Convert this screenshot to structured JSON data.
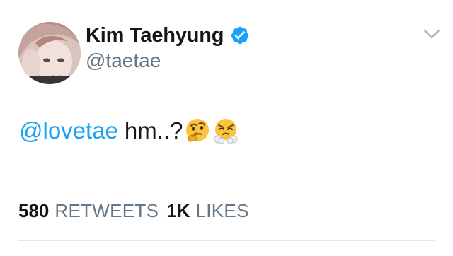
{
  "user": {
    "display_name": "Kim Taehyung",
    "handle": "@taetae",
    "verified": true
  },
  "tweet": {
    "mention": "@lovetae",
    "text": "hm..?",
    "emojis": [
      "thinking-face-emoji",
      "face-with-steam-from-nose-emoji"
    ]
  },
  "stats": {
    "retweets_count": "580",
    "retweets_label": "RETWEETS",
    "likes_count": "1K",
    "likes_label": "LIKES"
  },
  "colors": {
    "accent": "#1da1f2",
    "text": "#14171a",
    "secondary": "#657786",
    "divider": "#e1e8ed"
  }
}
